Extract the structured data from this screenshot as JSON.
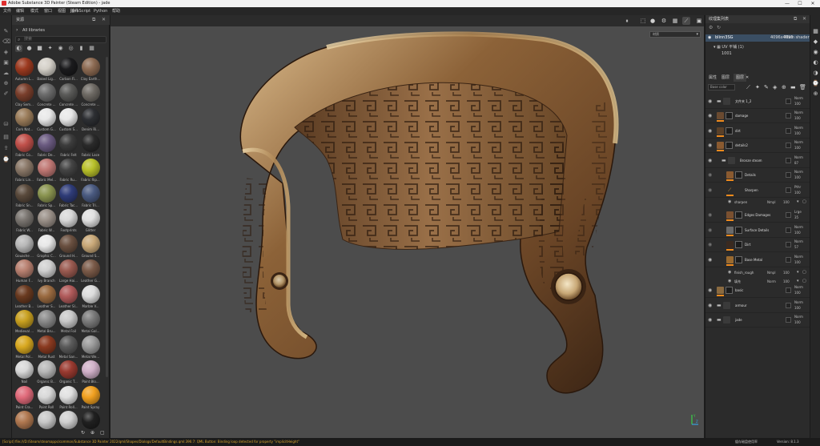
{
  "window": {
    "title": "Adobe Substance 3D Painter (Steam Edition) - jade",
    "minimize": "—",
    "maximize": "☐",
    "close": "✕"
  },
  "menubar": [
    "文件",
    "编辑",
    "模式",
    "窗口",
    "视图",
    "插件",
    "JavaScript",
    "Python",
    "帮助"
  ],
  "toolbar_left": [
    "paint-brush",
    "eraser",
    "projection",
    "polygon-fill",
    "smudge",
    "clone",
    "picker",
    "bake",
    "render",
    "share",
    "history"
  ],
  "shelf": {
    "title": "资源",
    "library": "All libraries",
    "search_placeholder": "搜索",
    "filters": [
      "materials",
      "smart-materials",
      "textures",
      "brushes",
      "filters",
      "particles",
      "tools",
      "alphas"
    ],
    "materials": [
      {
        "label": "Autumn L...",
        "color": "#9c3a20"
      },
      {
        "label": "Baked Lig...",
        "color": "#d4d0c8"
      },
      {
        "label": "Carbon Fi...",
        "color": "#1b1b1d"
      },
      {
        "label": "Clay Earth...",
        "color": "#8c6a52"
      },
      {
        "label": "Clay Sem...",
        "color": "#7a3f2c"
      },
      {
        "label": "Concrete ...",
        "color": "#6b6b6b"
      },
      {
        "label": "Concrete ...",
        "color": "#5a5a58"
      },
      {
        "label": "Concrete ...",
        "color": "#6e6a64"
      },
      {
        "label": "Cork Nat...",
        "color": "#9a7c5a"
      },
      {
        "label": "Custom G...",
        "color": "#e8e8e8"
      },
      {
        "label": "Custom S...",
        "color": "#e8e8e8"
      },
      {
        "label": "Denim Ri...",
        "color": "#2d2f33"
      },
      {
        "label": "Fabric Co...",
        "color": "#c0504a"
      },
      {
        "label": "Fabric De...",
        "color": "#6a5a80"
      },
      {
        "label": "Fabric Felt",
        "color": "#3c3c3c"
      },
      {
        "label": "Fabric Lace",
        "color": "#2a2a2a"
      },
      {
        "label": "Fabric Lin...",
        "color": "#8a7868"
      },
      {
        "label": "Fabric Mel...",
        "color": "#c07874"
      },
      {
        "label": "Fabric Ru...",
        "color": "#444444"
      },
      {
        "label": "Fabric Rip...",
        "color": "#b8c02a"
      },
      {
        "label": "Fabric Sn...",
        "color": "#5a4a3c"
      },
      {
        "label": "Fabric Sp...",
        "color": "#8a9450"
      },
      {
        "label": "Fabric Tac...",
        "color": "#2f3c78"
      },
      {
        "label": "Fabric Tri...",
        "color": "#4a5a80"
      },
      {
        "label": "Fabric W...",
        "color": "#7a7570"
      },
      {
        "label": "Fabric W...",
        "color": "#9a9088"
      },
      {
        "label": "Footprints",
        "color": "#d8d8d8"
      },
      {
        "label": "Glitter",
        "color": "#e0e0e0"
      },
      {
        "label": "Gouache ...",
        "color": "#b8b8b8"
      },
      {
        "label": "Graphic C...",
        "color": "#e8e8e8"
      },
      {
        "label": "Ground H...",
        "color": "#6a5040"
      },
      {
        "label": "Ground S...",
        "color": "#c8a878"
      },
      {
        "label": "Human F...",
        "color": "#b88070"
      },
      {
        "label": "Ivy Branch",
        "color": "#d0d0d0"
      },
      {
        "label": "Large Hai...",
        "color": "#9a5a50"
      },
      {
        "label": "Leather G...",
        "color": "#7a5a48"
      },
      {
        "label": "Leather B...",
        "color": "#6a3a20"
      },
      {
        "label": "Leather S...",
        "color": "#9a6a40"
      },
      {
        "label": "Leather Sl...",
        "color": "#b05a5a"
      },
      {
        "label": "Marble V...",
        "color": "#dcdcdc"
      },
      {
        "label": "Medieval ...",
        "color": "#c8a020"
      },
      {
        "label": "Metal Bru...",
        "color": "#8a8a8a"
      },
      {
        "label": "Metal Foil",
        "color": "#c8c8c8"
      },
      {
        "label": "Metal Gal...",
        "color": "#7a7a7a"
      },
      {
        "label": "Metal Pol...",
        "color": "#d8a820"
      },
      {
        "label": "Metal Rust",
        "color": "#8a3a20"
      },
      {
        "label": "Metal San...",
        "color": "#5a5a5a"
      },
      {
        "label": "Metal We...",
        "color": "#9a9a9a"
      },
      {
        "label": "Nail",
        "color": "#d8d8d8"
      },
      {
        "label": "Organic B...",
        "color": "#b8b8b8"
      },
      {
        "label": "Organic T...",
        "color": "#9a3a30"
      },
      {
        "label": "Paint Blo...",
        "color": "#d0b0c8"
      },
      {
        "label": "Paint Cra...",
        "color": "#e06a7a"
      },
      {
        "label": "Paint Roll",
        "color": "#d8d8d8"
      },
      {
        "label": "Paint Roll...",
        "color": "#e0e0e0"
      },
      {
        "label": "Paint Spray",
        "color": "#f0a020"
      },
      {
        "label": "",
        "color": "#b07850"
      },
      {
        "label": "",
        "color": "#c8c8c8"
      },
      {
        "label": "",
        "color": "#d0d0d0"
      },
      {
        "label": "",
        "color": "#202020"
      }
    ],
    "footer_icons": [
      "refresh-icon",
      "add-icon",
      "import-icon"
    ]
  },
  "viewport": {
    "toolbar": [
      "pause",
      "camera-persp",
      "camera",
      "brush-settings",
      "grid",
      "slash-tool",
      "screenshot",
      "display"
    ],
    "channel_select": "材质",
    "axis_labels": {
      "y": "Y",
      "z": "Z"
    }
  },
  "texture_set": {
    "panel_title": "纹理集列表",
    "name": "blinn3SG",
    "resolution": "4096x4096",
    "shader": "Main shader",
    "uv_label": "UV 平铺 (1)",
    "uv_tile": "1001"
  },
  "layers_panel": {
    "tabs": [
      "属性",
      "图层",
      "图层"
    ],
    "active_tab": 2,
    "blend_select": "Base color",
    "layers": [
      {
        "name": "文件夹 1_2",
        "blend": "Norm",
        "opacity": "100",
        "type": "folder",
        "indent": 0,
        "eye": true
      },
      {
        "name": "damage",
        "blend": "Norm",
        "opacity": "100",
        "type": "fill",
        "indent": 0,
        "eye": true,
        "color": "#6a4a30"
      },
      {
        "name": "dirt",
        "blend": "Norm",
        "opacity": "100",
        "type": "fill",
        "indent": 0,
        "eye": true,
        "color": "#5a4028"
      },
      {
        "name": "details2",
        "blend": "Norm",
        "opacity": "100",
        "type": "fill",
        "indent": 0,
        "eye": true,
        "color": "#8a5a30"
      },
      {
        "name": "Bronze steam",
        "blend": "Norm",
        "opacity": "87",
        "type": "folder",
        "indent": 1,
        "eye": true
      },
      {
        "name": "Details",
        "blend": "Norm",
        "opacity": "100",
        "type": "fill",
        "indent": 2,
        "eye": false,
        "color": "#8a5a30"
      },
      {
        "name": "Sharpen",
        "blend": "Pthr",
        "opacity": "100",
        "type": "filter",
        "indent": 2,
        "eye": false
      },
      {
        "name": "Edges Damages",
        "blend": "Lrge",
        "opacity": "35",
        "type": "fill",
        "indent": 2,
        "eye": false,
        "color": "#7a5030"
      },
      {
        "name": "Surface Details",
        "blend": "Norm",
        "opacity": "100",
        "type": "fill",
        "indent": 2,
        "eye": false,
        "color": "#6a6a6a"
      },
      {
        "name": "Dirt",
        "blend": "Norm",
        "opacity": "57",
        "type": "fill",
        "indent": 2,
        "eye": false,
        "color": "#3a2a20"
      },
      {
        "name": "Base Metal",
        "blend": "Norm",
        "opacity": "100",
        "type": "fill",
        "indent": 2,
        "eye": true,
        "color": "#9a6a30"
      },
      {
        "name": "basic",
        "blend": "Norm",
        "opacity": "100",
        "type": "fill",
        "indent": 0,
        "eye": true,
        "color": "#8a6a40"
      },
      {
        "name": "armour",
        "blend": "Norm",
        "opacity": "100",
        "type": "folder",
        "indent": 0,
        "eye": true
      },
      {
        "name": "jade",
        "blend": "Norm",
        "opacity": "100",
        "type": "folder",
        "indent": 0,
        "eye": true
      }
    ],
    "subs": [
      {
        "name": "sharpen",
        "blend": "Nmpl",
        "opacity": "100"
      },
      {
        "name": "finish_rough",
        "blend": "Nmpl",
        "opacity": "100"
      },
      {
        "name": "填充",
        "blend": "Norm",
        "opacity": "100"
      }
    ]
  },
  "statusbar": {
    "message": "[Script] file:///D:/Steam/steamapps/common/Substance 3D Painter 2022/qml/Shapes/Dialogs/DefaultBindings.qml:396:7: QML Button: Binding loop detected for property \"implicitHeight\"",
    "cache": "缓存磁盘使用率",
    "version": "Version: 8.1.3"
  }
}
